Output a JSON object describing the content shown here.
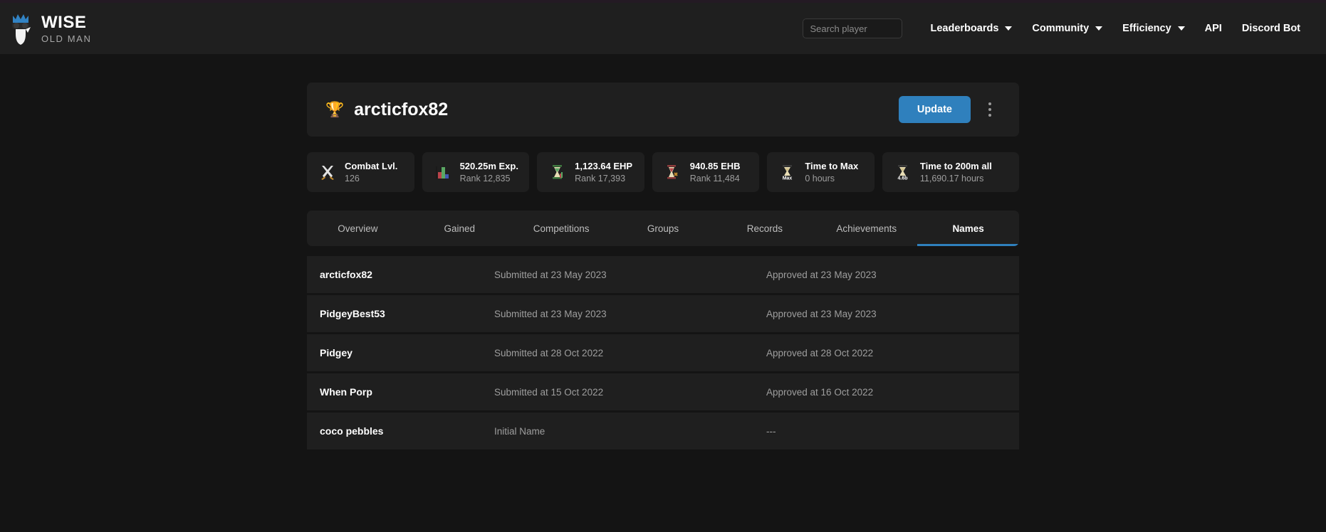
{
  "brand": {
    "title": "WISE",
    "subtitle": "OLD MAN",
    "logo_icon": "wise-old-man-logo-icon"
  },
  "nav": {
    "search_placeholder": "Search player",
    "search_value": "",
    "items": [
      {
        "label": "Leaderboards",
        "has_caret": true
      },
      {
        "label": "Community",
        "has_caret": true
      },
      {
        "label": "Efficiency",
        "has_caret": true
      },
      {
        "label": "API",
        "has_caret": false
      },
      {
        "label": "Discord Bot",
        "has_caret": false
      }
    ]
  },
  "player": {
    "trophy_icon": "🏆",
    "name": "arcticfox82",
    "update_label": "Update",
    "menu_icon": "kebab-menu-icon"
  },
  "stats": [
    {
      "icon": "crossed-swords-icon",
      "title": "Combat Lvl.",
      "sub": "126"
    },
    {
      "icon": "bar-chart-icon",
      "title": "520.25m Exp.",
      "sub": "Rank 12,835"
    },
    {
      "icon": "hourglass-green-icon",
      "title": "1,123.64 EHP",
      "sub": "Rank 17,393"
    },
    {
      "icon": "hourglass-red-icon",
      "title": "940.85 EHB",
      "sub": "Rank 11,484"
    },
    {
      "icon": "hourglass-max-icon",
      "title": "Time to Max",
      "sub": "0 hours"
    },
    {
      "icon": "hourglass-200m-icon",
      "title": "Time to 200m all",
      "sub": "11,690.17 hours"
    }
  ],
  "tabs": [
    {
      "label": "Overview",
      "active": false
    },
    {
      "label": "Gained",
      "active": false
    },
    {
      "label": "Competitions",
      "active": false
    },
    {
      "label": "Groups",
      "active": false
    },
    {
      "label": "Records",
      "active": false
    },
    {
      "label": "Achievements",
      "active": false
    },
    {
      "label": "Names",
      "active": true
    }
  ],
  "names": [
    {
      "name": "arcticfox82",
      "submitted": "Submitted at 23 May 2023",
      "approved": "Approved at 23 May 2023"
    },
    {
      "name": "PidgeyBest53",
      "submitted": "Submitted at 23 May 2023",
      "approved": "Approved at 23 May 2023"
    },
    {
      "name": "Pidgey",
      "submitted": "Submitted at 28 Oct 2022",
      "approved": "Approved at 28 Oct 2022"
    },
    {
      "name": "When Porp",
      "submitted": "Submitted at 15 Oct 2022",
      "approved": "Approved at 16 Oct 2022"
    },
    {
      "name": "coco pebbles",
      "submitted": "Initial Name",
      "approved": "---"
    }
  ],
  "colors": {
    "page_bg": "#141414",
    "card_bg": "#1f1f1f",
    "accent_blue": "#2f80bd",
    "text_primary": "#ffffff",
    "text_muted": "#9e9e9e",
    "logo_blue": "#3283c4"
  }
}
